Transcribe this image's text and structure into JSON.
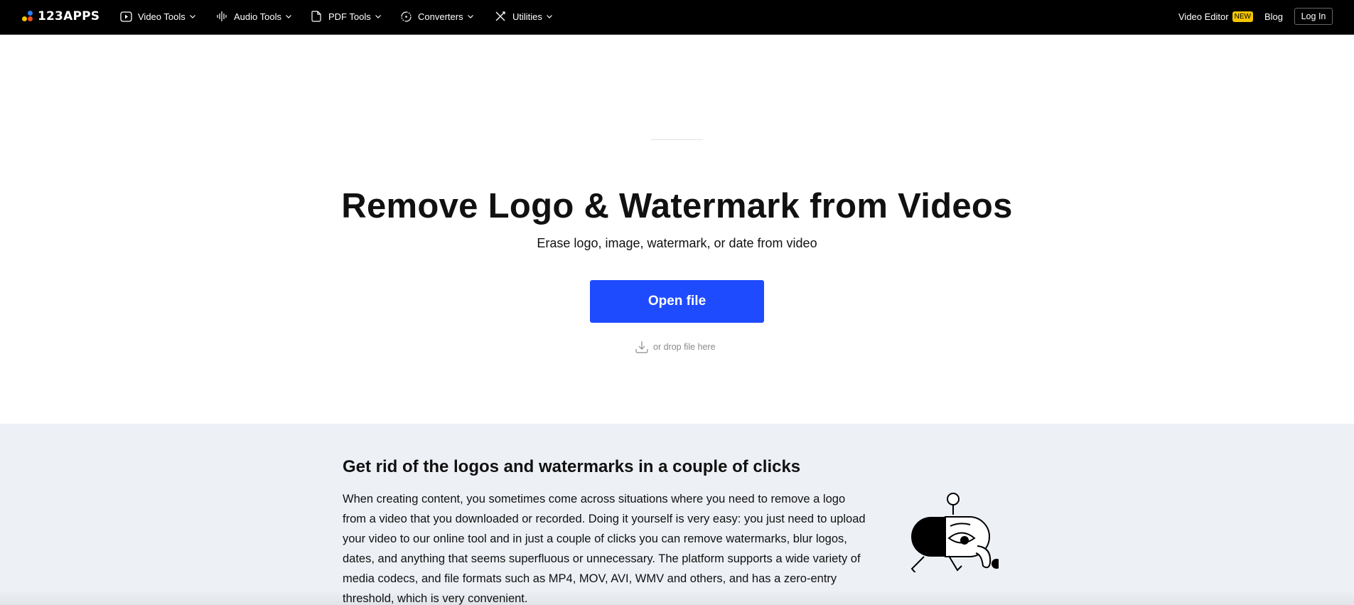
{
  "header": {
    "logo_text": "123APPS",
    "logo_colors": [
      "#2d7cf6",
      "#f5c400",
      "#f24c1c"
    ],
    "nav": [
      {
        "label": "Video Tools",
        "icon": "play-circle-icon"
      },
      {
        "label": "Audio Tools",
        "icon": "waveform-icon"
      },
      {
        "label": "PDF Tools",
        "icon": "document-icon"
      },
      {
        "label": "Converters",
        "icon": "refresh-icon"
      },
      {
        "label": "Utilities",
        "icon": "tools-icon"
      }
    ],
    "video_editor_label": "Video Editor",
    "new_badge": "NEW",
    "blog_label": "Blog",
    "login_label": "Log In"
  },
  "hero": {
    "title": "Remove Logo & Watermark from Videos",
    "subtitle": "Erase logo, image, watermark, or date from video",
    "open_button": "Open file",
    "drop_hint": "or drop file here",
    "accent": "#1f4bff"
  },
  "section": {
    "title": "Get rid of the logos and watermarks in a couple of clicks",
    "body": "When creating content, you sometimes come across situations where you need to remove a logo from a video that you downloaded or recorded. Doing it yourself is very easy: you just need to upload your video to our online tool and in just a couple of clicks you can remove watermarks, blur logos, dates, and anything that seems superfluous or unnecessary. The platform supports a wide variety of media codecs, and file formats such as MP4, MOV, AVI, WMV and others, and has a zero-entry threshold, which is very convenient.",
    "background": "#edf0f5"
  }
}
